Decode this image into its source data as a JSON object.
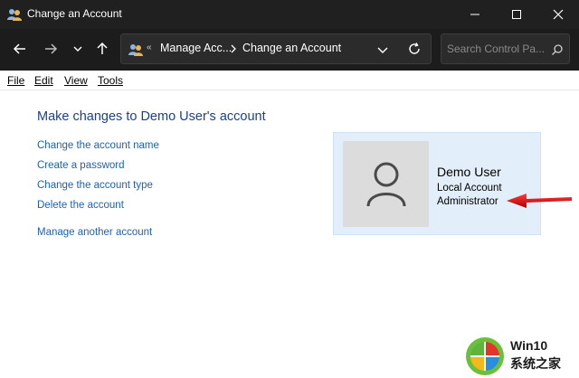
{
  "window": {
    "title": "Change an Account",
    "icon": "user-accounts-icon"
  },
  "nav": {
    "breadcrumb_sep": "«",
    "crumb1": "Manage Acc...",
    "crumb2": "Change an Account",
    "search_placeholder": "Search Control Pa..."
  },
  "menu": {
    "file": "File",
    "edit": "Edit",
    "view": "View",
    "tools": "Tools"
  },
  "content": {
    "heading": "Make changes to Demo User's account",
    "links": [
      "Change the account name",
      "Create a password",
      "Change the account type",
      "Delete the account",
      "Manage another account"
    ]
  },
  "account": {
    "name": "Demo User",
    "type": "Local Account",
    "role": "Administrator",
    "avatar_icon": "user-silhouette-icon"
  },
  "annotation": {
    "arrow_icon": "red-arrow-icon",
    "arrow_color": "#d40000"
  },
  "watermark": {
    "line1": "Win10",
    "line2": "系统之家"
  },
  "colors": {
    "titlebar": "#202020",
    "heading": "#1e3f8c",
    "link": "#1a62b6",
    "card_bg": "#e2eef9"
  }
}
